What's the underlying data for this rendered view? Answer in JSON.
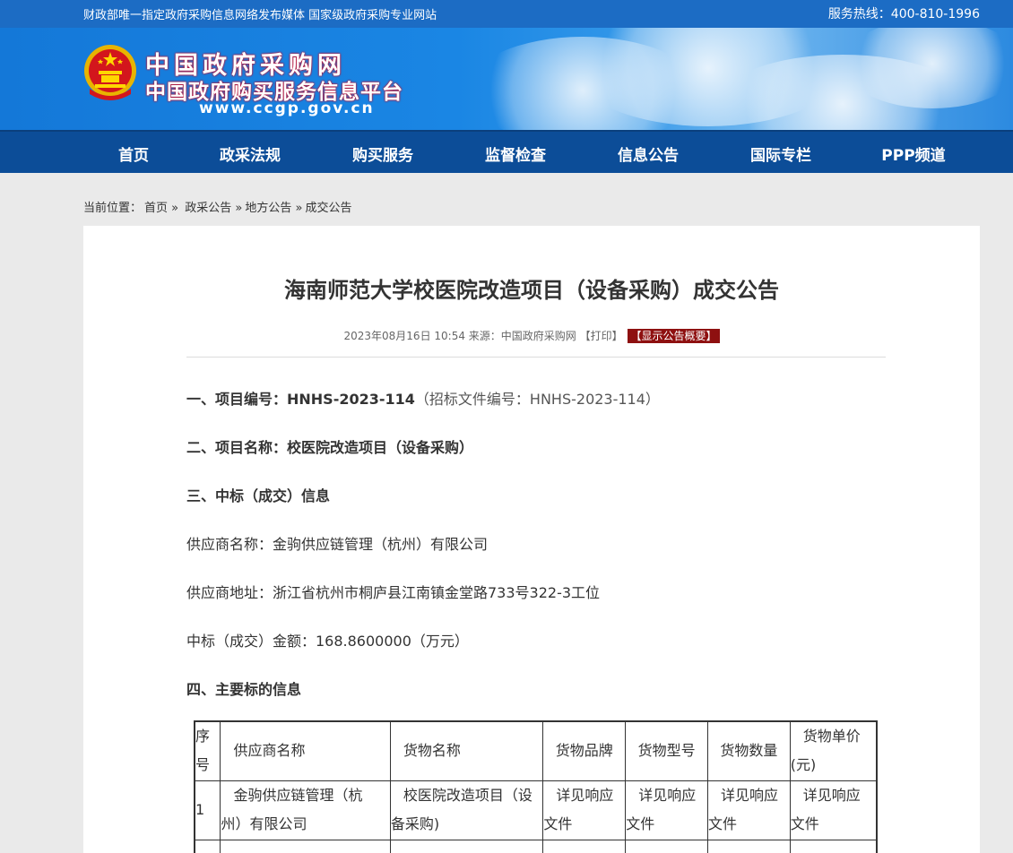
{
  "topbar": {
    "slogan": "财政部唯一指定政府采购信息网络发布媒体 国家级政府采购专业网站",
    "hotline": "服务热线：400-810-1996"
  },
  "header": {
    "site_name": "中国政府采购网",
    "site_subtitle": "中国政府购买服务信息平台",
    "site_url": "www.ccgp.gov.cn"
  },
  "nav": [
    "首页",
    "政采法规",
    "购买服务",
    "监督检查",
    "信息公告",
    "国际专栏",
    "PPP频道"
  ],
  "breadcrumb": {
    "prefix": "当前位置：",
    "items": [
      "首页 »",
      "政采公告 »",
      "地方公告 »",
      "成交公告"
    ]
  },
  "article": {
    "title": "海南师范大学校医院改造项目（设备采购）成交公告",
    "meta_date": "2023年08月16日 10:54",
    "meta_source": "来源：中国政府采购网",
    "meta_print": "【打印】",
    "meta_summary": "【显示公告概要】",
    "s1_label": "一、项目编号：HNHS-2023-114",
    "s1_extra": "（招标文件编号：HNHS-2023-114）",
    "s2": "二、项目名称：校医院改造项目（设备采购）",
    "s3": "三、中标（成交）信息",
    "supplier_name": "供应商名称：金驹供应链管理（杭州）有限公司",
    "supplier_addr": "供应商地址：浙江省杭州市桐庐县江南镇金堂路733号322-3工位",
    "amount": "中标（成交）金额：168.8600000（万元）",
    "s4": "四、主要标的信息"
  },
  "table": {
    "headers": {
      "seq_a": "序",
      "seq_b": "号",
      "supplier": "供应商名称",
      "goods": "货物名称",
      "brand": "货物品牌",
      "model": "货物型号",
      "qty": "货物数量",
      "price_a": "货物单价",
      "price_b": "(元)"
    },
    "row1": {
      "seq": "1",
      "supplier_a": "金驹供应链管理（杭",
      "supplier_b": "州）有限公司",
      "goods_a": "校医院改造项目（设",
      "goods_b": "备采购)",
      "brand_a": "详见响应",
      "brand_b": "文件",
      "model_a": "详见响应",
      "model_b": "文件",
      "qty_a": "详见响应",
      "qty_b": "文件",
      "price_a": "详见响应",
      "price_b": "文件"
    }
  },
  "colors": {
    "topbar": "#1c6cc4",
    "nav": "#0c4d98",
    "summary_tag": "#8e1010"
  }
}
